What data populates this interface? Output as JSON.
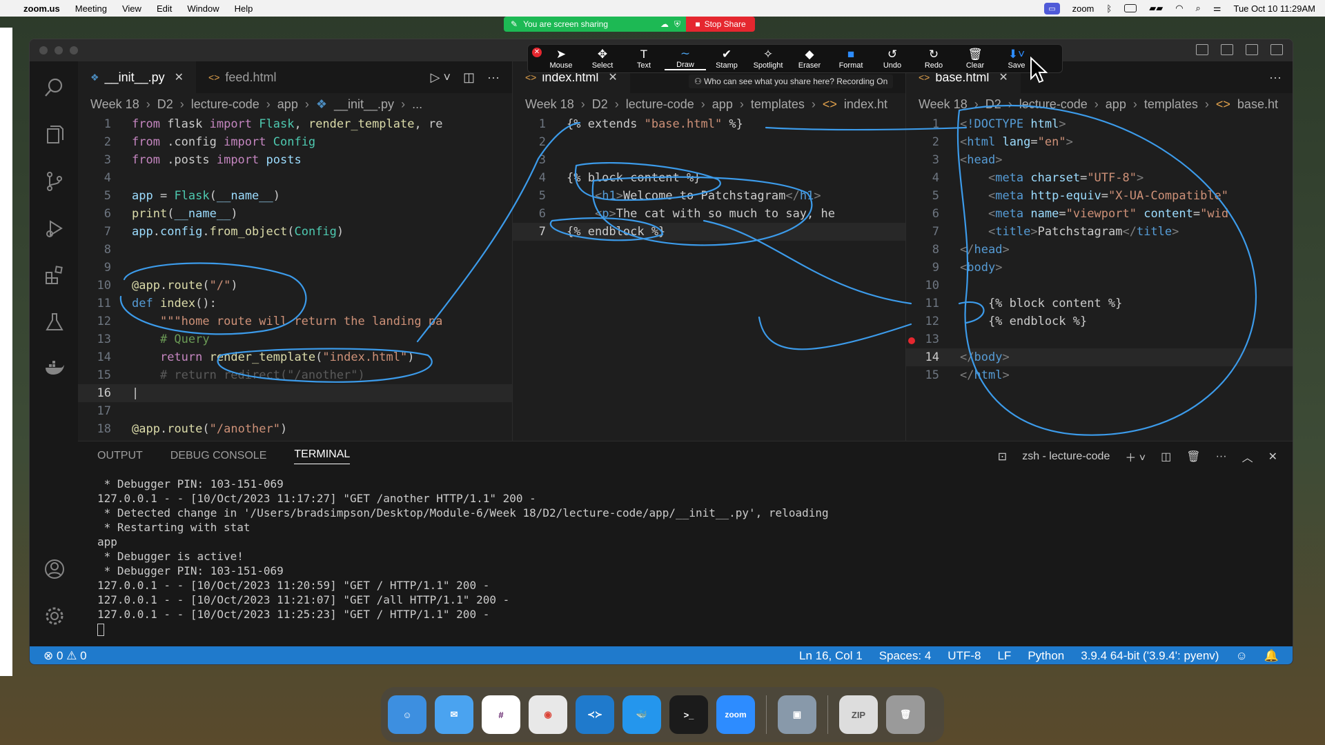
{
  "menubar": {
    "app": "zoom.us",
    "items": [
      "Meeting",
      "View",
      "Edit",
      "Window",
      "Help"
    ],
    "right_app": "zoom",
    "datetime": "Tue Oct 10  11:29AM"
  },
  "share_banner": {
    "status": "You are screen sharing",
    "stop_label": "Stop Share"
  },
  "annotate_toolbar": {
    "tools": [
      {
        "label": "Mouse",
        "icon": "cursor-icon"
      },
      {
        "label": "Select",
        "icon": "move-icon"
      },
      {
        "label": "Text",
        "icon": "text-icon"
      },
      {
        "label": "Draw",
        "icon": "draw-icon"
      },
      {
        "label": "Stamp",
        "icon": "check-icon"
      },
      {
        "label": "Spotlight",
        "icon": "wand-icon"
      },
      {
        "label": "Eraser",
        "icon": "eraser-icon"
      },
      {
        "label": "Format",
        "icon": "square-icon"
      },
      {
        "label": "Undo",
        "icon": "undo-icon"
      },
      {
        "label": "Redo",
        "icon": "redo-icon"
      },
      {
        "label": "Clear",
        "icon": "trash-icon"
      },
      {
        "label": "Save",
        "icon": "save-icon"
      }
    ],
    "who_can_see": "Who can see what you share here? Recording On"
  },
  "editor_left": {
    "tabs": [
      {
        "label": "__init__.py",
        "active": true
      },
      {
        "label": "feed.html",
        "active": false
      }
    ],
    "breadcrumb": [
      "Week 18",
      "D2",
      "lecture-code",
      "app",
      "__init__.py",
      "..."
    ],
    "line_numbers": [
      "1",
      "2",
      "3",
      "4",
      "5",
      "6",
      "7",
      "8",
      "9",
      "10",
      "11",
      "12",
      "13",
      "14",
      "15",
      "16",
      "17",
      "18"
    ]
  },
  "editor_mid": {
    "tabs": [
      {
        "label": "index.html",
        "active": true
      }
    ],
    "breadcrumb": [
      "Week 18",
      "D2",
      "lecture-code",
      "app",
      "templates",
      "index.ht"
    ],
    "line_numbers": [
      "1",
      "2",
      "3",
      "4",
      "5",
      "6",
      "7"
    ]
  },
  "editor_right": {
    "tabs": [
      {
        "label": "base.html",
        "active": true
      }
    ],
    "breadcrumb": [
      "Week 18",
      "D2",
      "lecture-code",
      "app",
      "templates",
      "base.ht"
    ],
    "line_numbers": [
      "1",
      "2",
      "3",
      "4",
      "5",
      "6",
      "7",
      "8",
      "9",
      "10",
      "11",
      "12",
      "13",
      "14",
      "15"
    ]
  },
  "panel": {
    "tabs": [
      "OUTPUT",
      "DEBUG CONSOLE",
      "TERMINAL"
    ],
    "active_tab": "TERMINAL",
    "terminal_name": "zsh - lecture-code",
    "lines": [
      " * Debugger PIN: 103-151-069",
      "127.0.0.1 - - [10/Oct/2023 11:17:27] \"GET /another HTTP/1.1\" 200 -",
      " * Detected change in '/Users/bradsimpson/Desktop/Module-6/Week 18/D2/lecture-code/app/__init__.py', reloading",
      " * Restarting with stat",
      "app",
      " * Debugger is active!",
      " * Debugger PIN: 103-151-069",
      "127.0.0.1 - - [10/Oct/2023 11:20:59] \"GET / HTTP/1.1\" 200 -",
      "127.0.0.1 - - [10/Oct/2023 11:21:07] \"GET /all HTTP/1.1\" 200 -",
      "127.0.0.1 - - [10/Oct/2023 11:25:23] \"GET / HTTP/1.1\" 200 -"
    ]
  },
  "statusbar": {
    "errors": "0",
    "warnings": "0",
    "position": "Ln 16, Col 1",
    "spaces": "Spaces: 4",
    "encoding": "UTF-8",
    "eol": "LF",
    "language": "Python",
    "interpreter": "3.9.4 64-bit ('3.9.4': pyenv)"
  },
  "dock": {
    "apps": [
      {
        "name": "Finder",
        "color": "#3d8fe0"
      },
      {
        "name": "Mail",
        "color": "#4aa3f0"
      },
      {
        "name": "Slack",
        "color": "#ffffff"
      },
      {
        "name": "Chrome",
        "color": "#e8e8e8"
      },
      {
        "name": "VS Code",
        "color": "#1f7acc"
      },
      {
        "name": "Docker",
        "color": "#2496ed"
      },
      {
        "name": "Terminal",
        "color": "#1b1b1b"
      },
      {
        "name": "Zoom",
        "color": "#2d8cff"
      },
      {
        "name": "Preview",
        "color": "#8899aa"
      },
      {
        "name": "Archive",
        "color": "#dddddd"
      },
      {
        "name": "Trash",
        "color": "#9a9a9a"
      }
    ],
    "zoom_label": "zoom"
  },
  "accent": "#1f7acc"
}
